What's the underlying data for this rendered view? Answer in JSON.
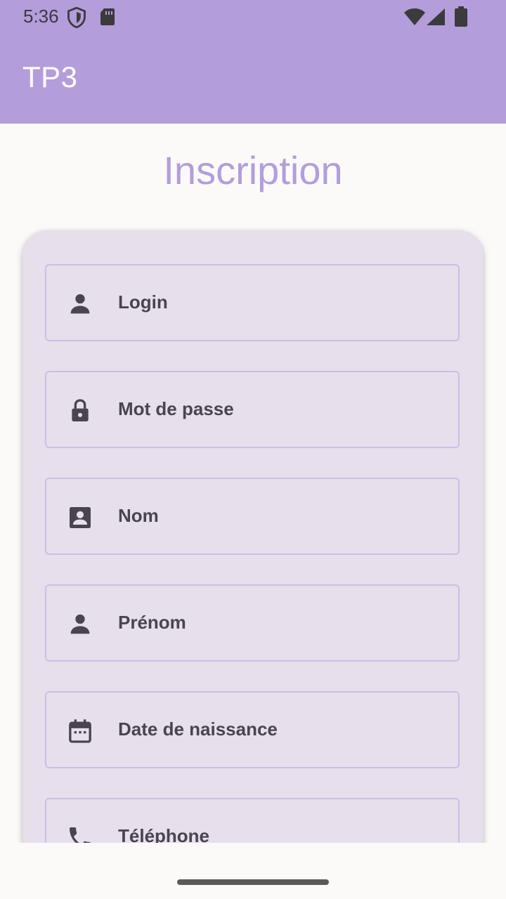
{
  "status_bar": {
    "time": "5:36",
    "icons": [
      "shield-icon",
      "sd-card-icon",
      "wifi-icon",
      "signal-icon",
      "battery-icon"
    ]
  },
  "app_bar": {
    "title": "TP3"
  },
  "page": {
    "heading": "Inscription"
  },
  "form": {
    "fields": [
      {
        "label": "Login",
        "icon": "person-icon"
      },
      {
        "label": "Mot de passe",
        "icon": "lock-icon"
      },
      {
        "label": "Nom",
        "icon": "contact-card-icon"
      },
      {
        "label": "Prénom",
        "icon": "person-icon"
      },
      {
        "label": "Date de naissance",
        "icon": "calendar-icon"
      },
      {
        "label": "Téléphone",
        "icon": "phone-icon"
      }
    ]
  },
  "colors": {
    "primary": "#b39ddb",
    "card": "#e7dfec",
    "field_border": "#cbbfe6",
    "label_text": "#49454f"
  }
}
